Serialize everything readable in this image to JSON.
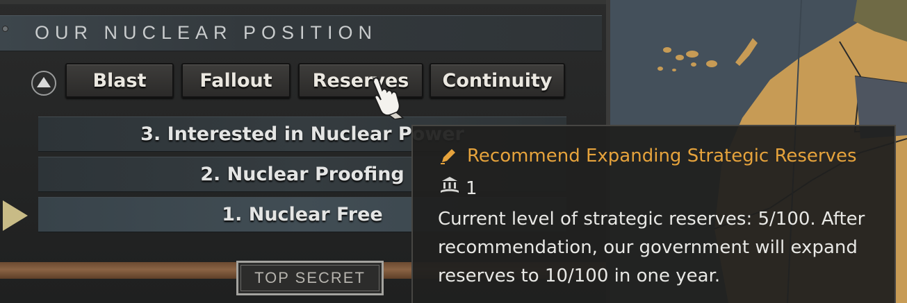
{
  "panel": {
    "title": "OUR NUCLEAR POSITION",
    "tabs": [
      {
        "label": "Blast"
      },
      {
        "label": "Fallout"
      },
      {
        "label": "Reserves"
      },
      {
        "label": "Continuity"
      }
    ],
    "levels": [
      {
        "label": "3. Interested in Nuclear Power"
      },
      {
        "label": "2. Nuclear Proofing"
      },
      {
        "label": "1. Nuclear Free"
      }
    ],
    "current_level": "1. Nuclear Free",
    "stamp": "TOP SECRET"
  },
  "tooltip": {
    "title": "Recommend Expanding Strategic Reserves",
    "cost": "1",
    "cost_icon": "bank-icon",
    "title_icon": "pencil-icon",
    "body": "Current level of strategic reserves: 5/100. After recommendation, our government will expand reserves to 10/100 in one year."
  },
  "colors": {
    "accent": "#e6a33c",
    "selected_arrow": "#c8bb86",
    "land": "#c79b55",
    "sea": "#44505b"
  }
}
